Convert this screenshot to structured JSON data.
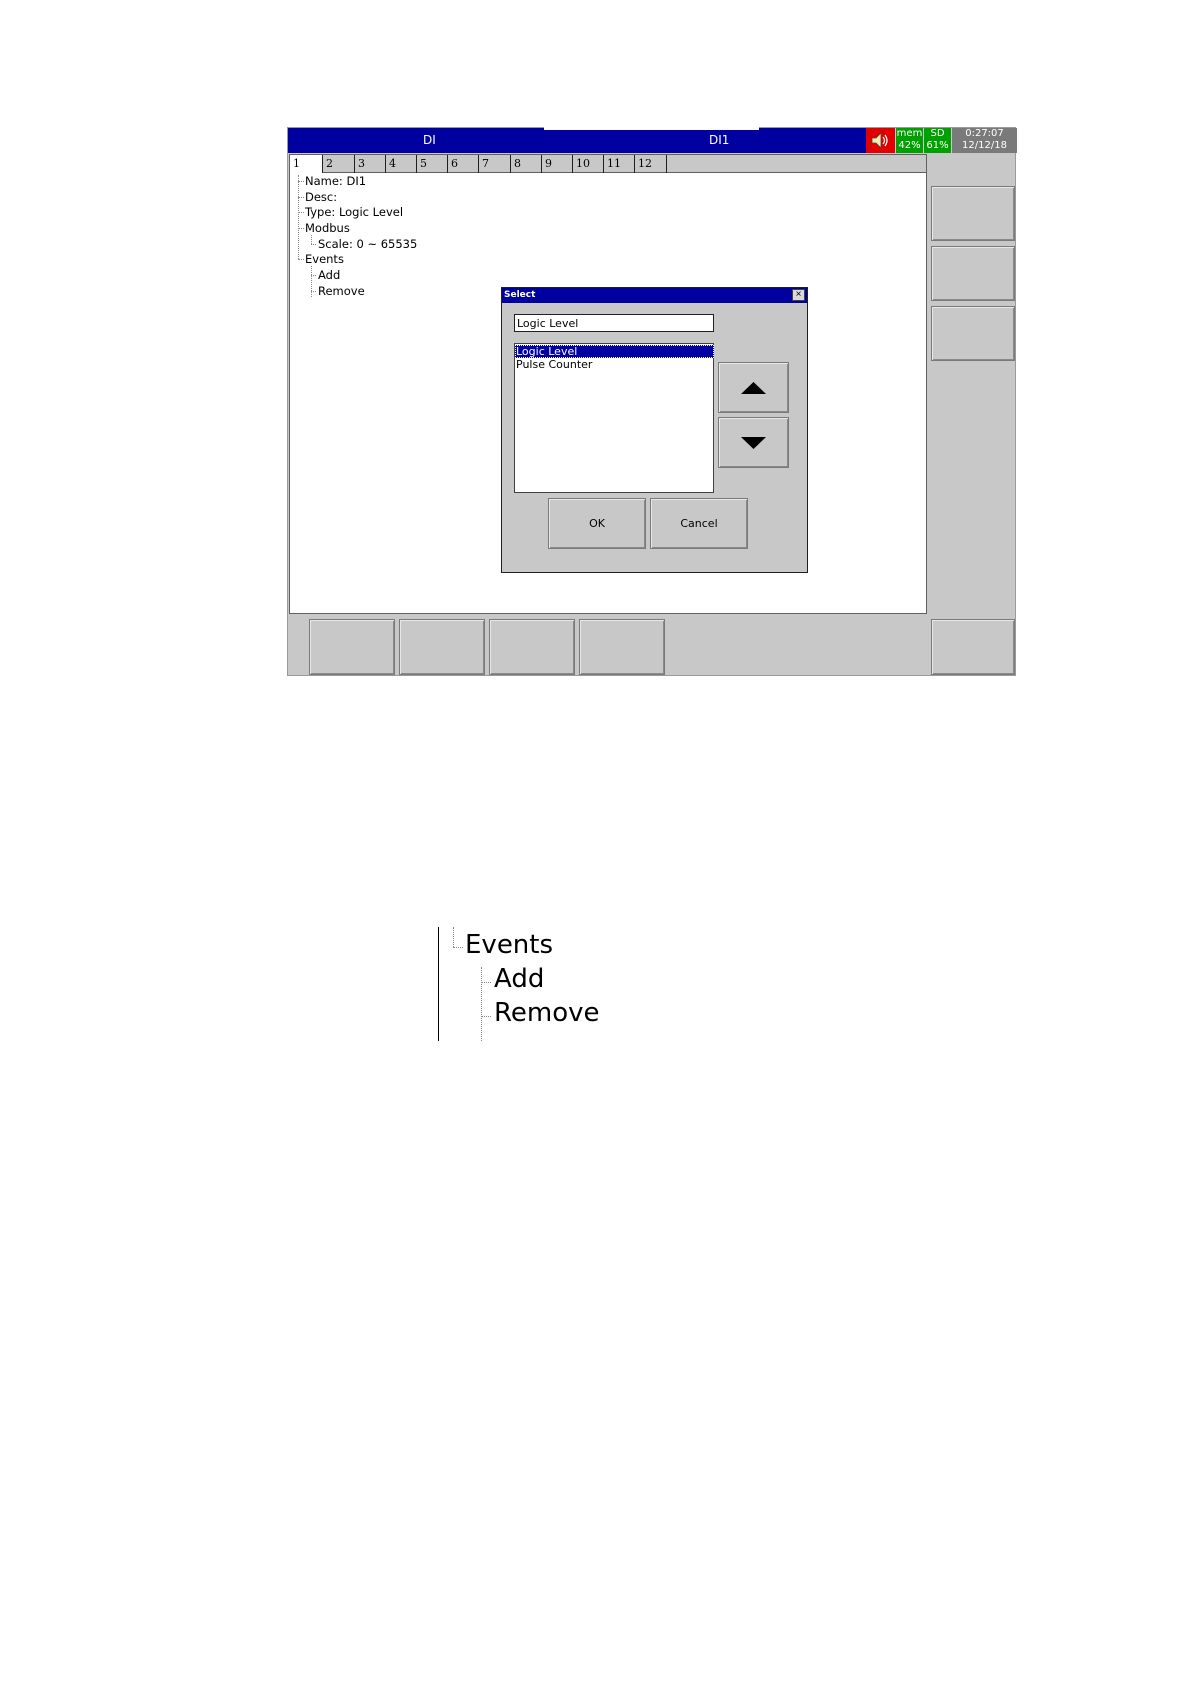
{
  "header": {
    "left_title": "DI",
    "right_title": "DI1",
    "mem_label": "mem",
    "mem_value": "42%",
    "sd_label": "SD",
    "sd_value": "61%",
    "time": "0:27:07",
    "date": "12/12/18",
    "speaker_icon": "speaker-icon",
    "colors": {
      "title_bg": "#0000a0",
      "speaker_bg": "#e00000",
      "status_bg": "#00a000",
      "clock_bg": "#7a7a7a"
    }
  },
  "tabs": [
    "1",
    "2",
    "3",
    "4",
    "5",
    "6",
    "7",
    "8",
    "9",
    "10",
    "11",
    "12"
  ],
  "active_tab": "1",
  "tree": {
    "name": "Name: DI1",
    "desc": "Desc:",
    "type": "Type: Logic Level",
    "modbus": "Modbus",
    "scale": "Scale: 0 ~ 65535",
    "events": "Events",
    "add": "Add",
    "remove": "Remove"
  },
  "dialog": {
    "title": "Select",
    "close_label": "×",
    "input_value": "Logic Level",
    "options": [
      "Logic Level",
      "Pulse Counter"
    ],
    "selected_index": 0,
    "ok_label": "OK",
    "cancel_label": "Cancel",
    "up_icon": "triangle-up-icon",
    "down_icon": "triangle-down-icon"
  },
  "zoom_detail": {
    "events": "Events",
    "add": "Add",
    "remove": "Remove"
  }
}
